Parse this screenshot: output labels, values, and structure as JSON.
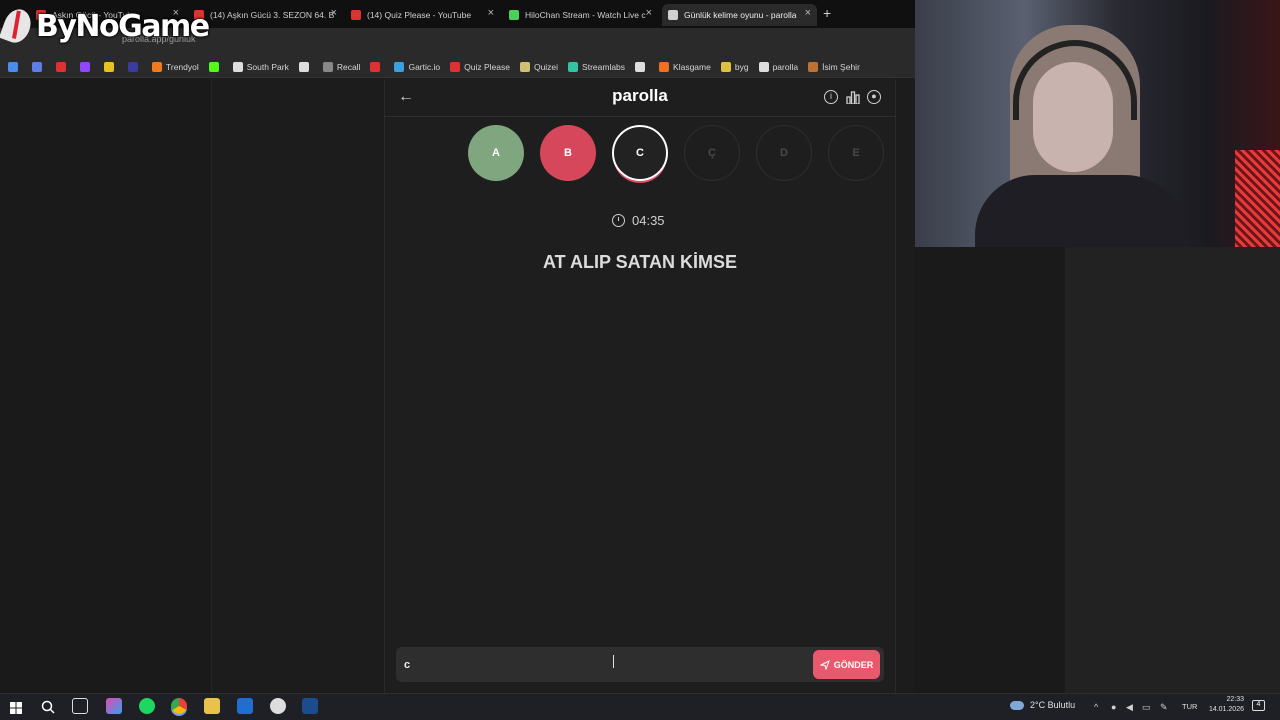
{
  "browser": {
    "tabs": [
      {
        "title": "Aşkın Gücü - YouTube",
        "color": "#e03030",
        "active": false
      },
      {
        "title": "(14) Aşkın Gücü 3. SEZON 64. B",
        "color": "#e03030",
        "active": false
      },
      {
        "title": "(14) Quiz Please - YouTube",
        "color": "#e03030",
        "active": false
      },
      {
        "title": "HiloChan Stream - Watch Live c",
        "color": "#48d25a",
        "active": false
      },
      {
        "title": "Günlük kelime oyunu - parolla",
        "color": "#d0d0d0",
        "active": true
      }
    ],
    "new_tab_label": "+",
    "close_label": "×",
    "address": "parolla.app/gunluk",
    "bookmarks": [
      {
        "label": "",
        "color": "#4a8df0"
      },
      {
        "label": "",
        "color": "#5c7ee8"
      },
      {
        "label": "",
        "color": "#e03030"
      },
      {
        "label": "",
        "color": "#9146ff"
      },
      {
        "label": "",
        "color": "#e8c020"
      },
      {
        "label": "",
        "color": "#3a3aa0"
      },
      {
        "label": "Trendyol",
        "color": "#f27a1a"
      },
      {
        "label": "",
        "color": "#53fc18"
      },
      {
        "label": "South Park",
        "color": "#dddddd"
      },
      {
        "label": "",
        "color": "#dddddd"
      },
      {
        "label": "Recall",
        "color": "#888888"
      },
      {
        "label": "",
        "color": "#e03030"
      },
      {
        "label": "Gartic.io",
        "color": "#3aa0e0"
      },
      {
        "label": "Quiz Please",
        "color": "#e03030"
      },
      {
        "label": "Quizei",
        "color": "#d0c070"
      },
      {
        "label": "Streamlabs",
        "color": "#31c3a2"
      },
      {
        "label": "",
        "color": "#dddddd"
      },
      {
        "label": "Klasgame",
        "color": "#f07020"
      },
      {
        "label": "byg",
        "color": "#e0c040"
      },
      {
        "label": "parolla",
        "color": "#dddddd"
      },
      {
        "label": "İsim Şehir",
        "color": "#c07030"
      }
    ]
  },
  "logo": {
    "text": "ByNoGame"
  },
  "app": {
    "title": "parolla",
    "back_icon": "arrow-left-icon",
    "header_icons": [
      "info-icon",
      "stats-icon",
      "profile-icon"
    ],
    "letters": [
      {
        "label": "A",
        "state": "correct"
      },
      {
        "label": "B",
        "state": "wrong"
      },
      {
        "label": "C",
        "state": "current"
      },
      {
        "label": "Ç",
        "state": "pending"
      },
      {
        "label": "D",
        "state": "pending"
      },
      {
        "label": "E",
        "state": "pending"
      }
    ],
    "timer": "04:35",
    "question": "AT ALIP SATAN KİMSE",
    "answer_value": "c",
    "send_label": "GÖNDER",
    "colors": {
      "correct": "#7fa67e",
      "wrong": "#d6475b",
      "accent": "#e8596d"
    }
  },
  "taskbar": {
    "weather": "2°C  Bulutlu",
    "language": "TUR",
    "time": "22:33",
    "date": "14.01.2026",
    "notification_count": "4"
  }
}
